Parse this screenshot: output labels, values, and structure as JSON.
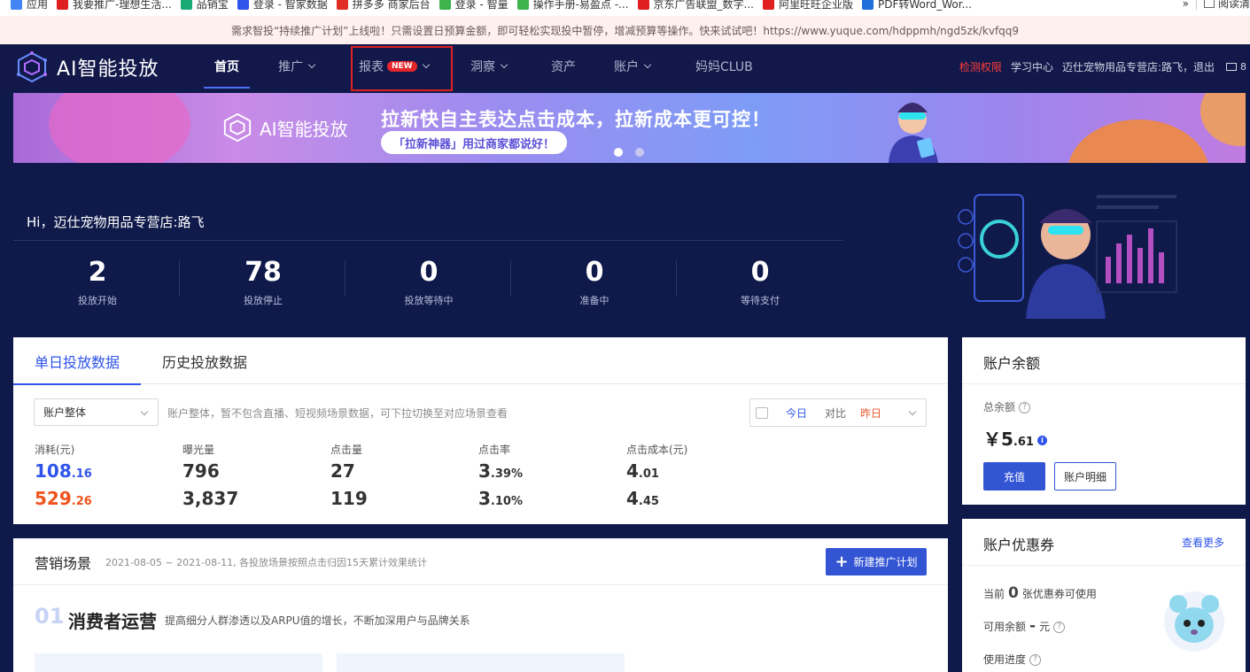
{
  "bookmarks": {
    "items": [
      {
        "label": "应用",
        "color": "#4285f4"
      },
      {
        "label": "我要推广-理想生活...",
        "color": "#e02020"
      },
      {
        "label": "品销宝",
        "color": "#19a974"
      },
      {
        "label": "登录 - 智家数据",
        "color": "#2f54eb"
      },
      {
        "label": "拼多多 商家后台",
        "color": "#e02e24"
      },
      {
        "label": "登录 - 智量",
        "color": "#3cb44b"
      },
      {
        "label": "操作手册-易盈点 -...",
        "color": "#3cb44b"
      },
      {
        "label": "京东广告联盟_数字...",
        "color": "#e02020"
      },
      {
        "label": "阿里旺旺企业版",
        "color": "#e02020"
      },
      {
        "label": "PDF转Word_Wor...",
        "color": "#1e6fd9"
      }
    ],
    "overflow": "»",
    "reading_list": "阅读清"
  },
  "notice": {
    "text": "需求智投“持续推广计划”上线啦！只需设置日预算金额，即可轻松实现投中暂停，增减预算等操作。快来试试吧！https://www.yuque.com/hdppmh/ngd5zk/kvfqq9"
  },
  "nav": {
    "logo": "AI智能投放",
    "items": {
      "home": "首页",
      "promote": "推广",
      "report": "报表",
      "report_badge": "NEW",
      "insight": "洞察",
      "assets": "资产",
      "account": "账户",
      "club": "妈妈CLUB"
    },
    "right": {
      "check": "检测权限",
      "learn": "学习中心",
      "user": "迈仕宠物用品专营店:路飞，退出",
      "mail_count": "8"
    }
  },
  "banner": {
    "logo": "AI智能投放",
    "title": "拉新快自主表达点击成本，拉新成本更可控！",
    "subtitle": "「拉新神器」用过商家都说好！"
  },
  "hero": {
    "greeting": "Hi，迈仕宠物用品专营店:路飞",
    "stats": [
      {
        "value": "2",
        "label": "投放开始"
      },
      {
        "value": "78",
        "label": "投放停止"
      },
      {
        "value": "0",
        "label": "投放等待中"
      },
      {
        "value": "0",
        "label": "准备中"
      },
      {
        "value": "0",
        "label": "等待支付"
      }
    ]
  },
  "daily": {
    "tabs": [
      "单日投放数据",
      "历史投放数据"
    ],
    "select_value": "账户整体",
    "hint": "账户整体，暂不包含直播、短视频场景数据，可下拉切换至对应场景查看",
    "date_today": "今日",
    "date_compare": "对比",
    "date_yesterday": "昨日",
    "metrics": [
      {
        "label": "消耗(元)",
        "v1": "108",
        "v1_dec": ".16",
        "v2": "529",
        "v2_dec": ".26"
      },
      {
        "label": "曝光量",
        "v1": "796",
        "v1_dec": "",
        "v2": "3,837",
        "v2_dec": ""
      },
      {
        "label": "点击量",
        "v1": "27",
        "v1_dec": "",
        "v2": "119",
        "v2_dec": ""
      },
      {
        "label": "点击率",
        "v1": "3",
        "v1_dec": ".39%",
        "v2": "3",
        "v2_dec": ".10%"
      },
      {
        "label": "点击成本(元)",
        "v1": "4",
        "v1_dec": ".01",
        "v2": "4",
        "v2_dec": ".45"
      }
    ]
  },
  "scene": {
    "title": "营销场景",
    "date": "2021-08-05 ~ 2021-08-11, 各投放场景按照点击归因15天累计效果统计",
    "new_button": "新建推广计划",
    "section_num": "01",
    "section_title": "消费者运营",
    "section_desc": "提高细分人群渗透以及ARPU值的增长，不断加深用户与品牌关系"
  },
  "balance": {
    "title": "账户余额",
    "total_label": "总余额",
    "currency": "￥",
    "amount": "5",
    "amount_dec": ".61",
    "recharge": "充值",
    "details": "账户明细"
  },
  "coupon": {
    "title": "账户优惠券",
    "more": "查看更多",
    "current_prefix": "当前",
    "current_count": "0",
    "current_suffix": "张优惠券可使用",
    "available_label": "可用余额",
    "available_value": "-",
    "available_unit": "元",
    "progress_label": "使用进度"
  }
}
